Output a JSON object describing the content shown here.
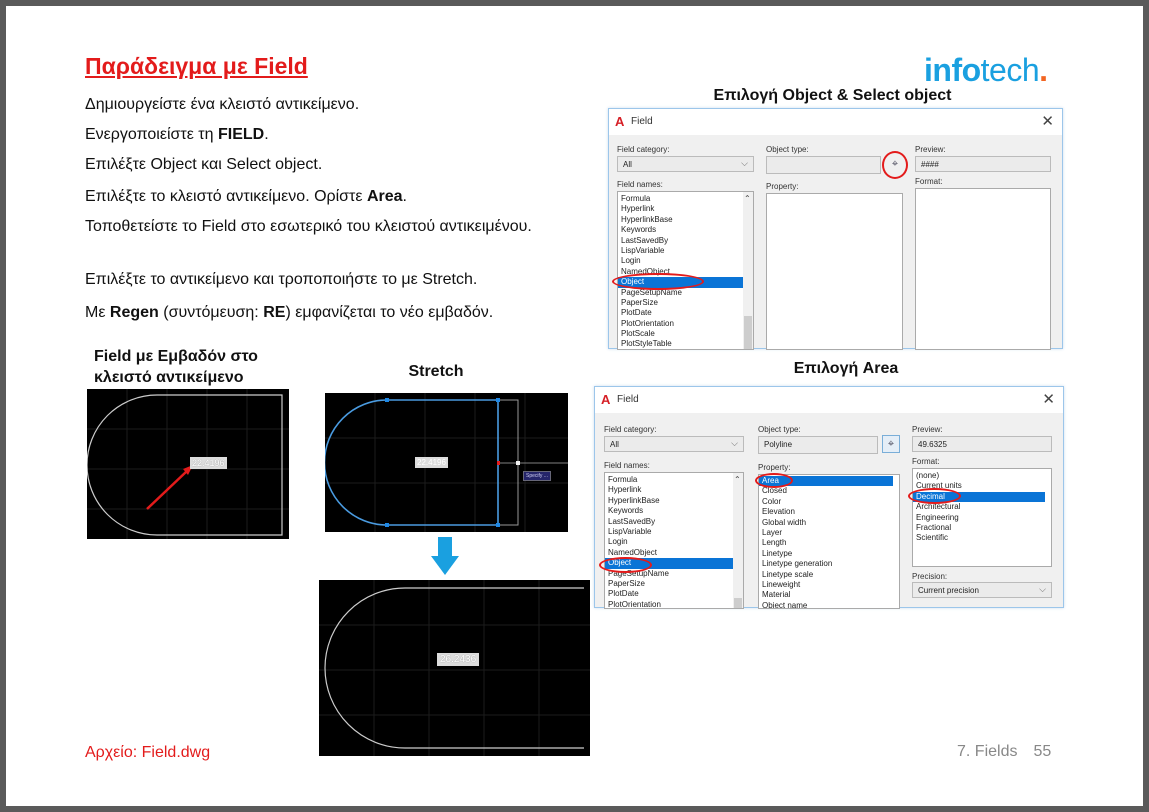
{
  "title": "Παράδειγμα με Field",
  "logo": {
    "part1": "info",
    "part2": "tech",
    "dot": ".",
    "brand_color": "#1aa0e0"
  },
  "steps": [
    {
      "pre": "Δημιουργείστε ένα κλειστό αντικείμενο.",
      "bold": "",
      "post": ""
    },
    {
      "pre": "Ενεργοποιείστε τη ",
      "bold": "FIELD",
      "post": "."
    },
    {
      "pre": "Επιλέξτε Object και Select object.",
      "bold": "",
      "post": ""
    },
    {
      "pre": "Επιλέξτε το κλειστό αντικείμενο. Ορίστε ",
      "bold": "Area",
      "post": "."
    },
    {
      "pre": "Τοποθετείστε το Field στο εσωτερικό του κλειστού αντικειμένου.",
      "bold": "",
      "post": ""
    },
    {
      "pre": "Επιλέξτε το αντικείμενο και τροποποιήστε το με Stretch.",
      "bold": "",
      "post": ""
    },
    {
      "pre": "Με ",
      "bold": "Regen",
      "post": " (συντόμευση: ",
      "bold2": "RE",
      "post2": ") εμφανίζεται το νέο εμβαδόν."
    }
  ],
  "captions": {
    "dialog1": "Επιλογή Object & Select object",
    "dialog2": "Επιλογή Area",
    "cad1": "Field με Εμβαδόν στο κλειστό αντικείμενο",
    "cad2": "Stretch"
  },
  "dialog1": {
    "title": "Field",
    "close": "✕",
    "category_label": "Field category:",
    "category_value": "All",
    "names_label": "Field names:",
    "names": [
      "Formula",
      "Hyperlink",
      "HyperlinkBase",
      "Keywords",
      "LastSavedBy",
      "LispVariable",
      "Login",
      "NamedObject",
      "Object",
      "PageSetupName",
      "PaperSize",
      "PlotDate",
      "PlotOrientation",
      "PlotScale",
      "PlotStyleTable"
    ],
    "names_selected": 8,
    "object_type_label": "Object type:",
    "object_type_value": "",
    "property_label": "Property:",
    "property": [],
    "preview_label": "Preview:",
    "preview_value": "####",
    "format_label": "Format:",
    "format": []
  },
  "dialog2": {
    "title": "Field",
    "close": "✕",
    "category_label": "Field category:",
    "category_value": "All",
    "names_label": "Field names:",
    "names": [
      "Formula",
      "Hyperlink",
      "HyperlinkBase",
      "Keywords",
      "LastSavedBy",
      "LispVariable",
      "Login",
      "NamedObject",
      "Object",
      "PageSetupName",
      "PaperSize",
      "PlotDate",
      "PlotOrientation"
    ],
    "names_selected": 8,
    "object_type_label": "Object type:",
    "object_type_value": "Polyline",
    "property_label": "Property:",
    "property": [
      "Area",
      "Closed",
      "Color",
      "Elevation",
      "Global width",
      "Layer",
      "Length",
      "Linetype",
      "Linetype generation",
      "Linetype scale",
      "Lineweight",
      "Material",
      "Object name"
    ],
    "property_selected": 0,
    "preview_label": "Preview:",
    "preview_value": "49.6325",
    "format_label": "Format:",
    "format": [
      "(none)",
      "Current units",
      "Decimal",
      "Architectural",
      "Engineering",
      "Fractional",
      "Scientific"
    ],
    "format_selected": 2,
    "precision_label": "Precision:",
    "precision_value": "Current precision"
  },
  "cad": {
    "field1": "22.4196",
    "field2": "22.4196",
    "field3": "26.2436",
    "tooltip": "Specify ..."
  },
  "footer": {
    "file": "Αρχείο: Field.dwg",
    "section": "7. Fields",
    "page": "55"
  }
}
